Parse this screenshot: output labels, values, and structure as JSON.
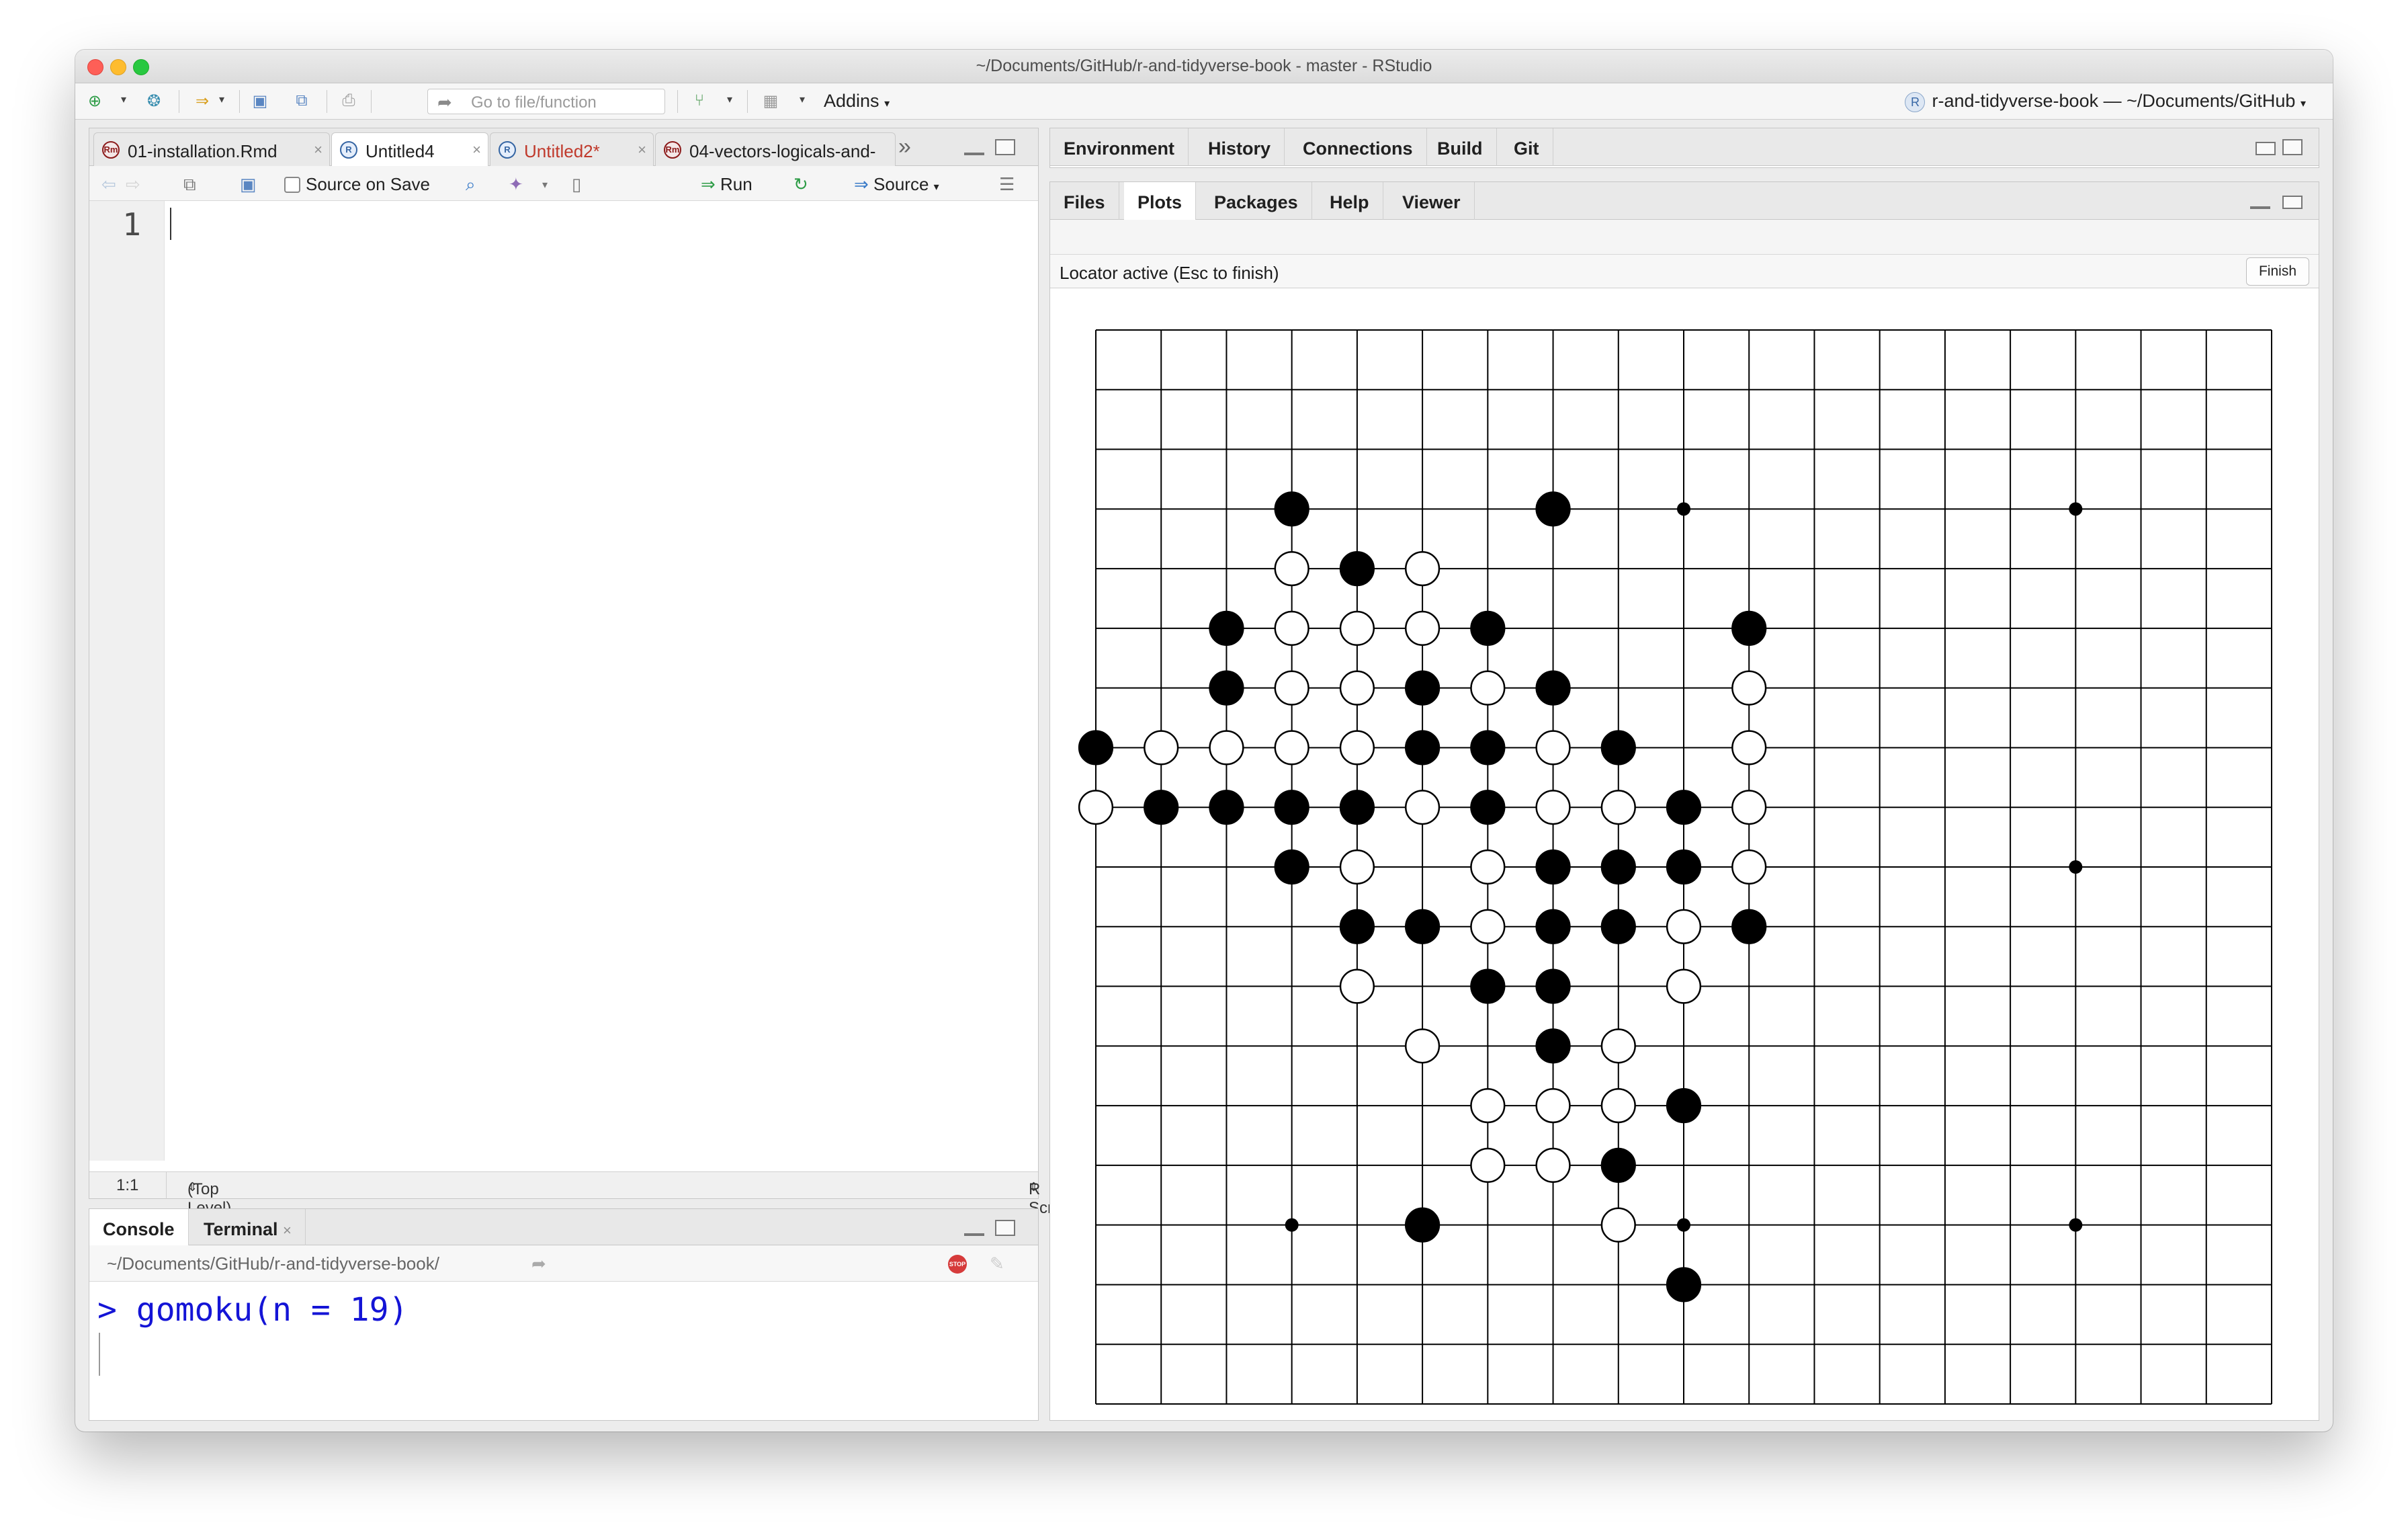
{
  "window": {
    "title": "~/Documents/GitHub/r-and-tidyverse-book - master - RStudio"
  },
  "toolbar": {
    "goto_placeholder": "Go to file/function",
    "addins_label": "Addins",
    "project_label": "r-and-tidyverse-book — ~/Documents/GitHub",
    "project_icon_letter": "R",
    "icons": [
      "new-file-icon",
      "new-project-icon",
      "open-file-icon",
      "save-icon",
      "save-all-icon",
      "print-icon",
      "git-icon",
      "workspace-panes-icon"
    ]
  },
  "editor": {
    "tabs": [
      {
        "label": "01-installation.Rmd",
        "icon": "rmd-file-icon"
      },
      {
        "label": "Untitled4",
        "icon": "r-file-icon"
      },
      {
        "label": "Untitled2*",
        "icon": "r-file-icon"
      },
      {
        "label": "04-vectors-logicals-and-",
        "icon": "rmd-file-icon"
      }
    ],
    "overflow_label": "»",
    "source_on_save": "Source on Save",
    "run_label": "Run",
    "source_label": "Source",
    "line_number": "1",
    "status": {
      "position": "1:1",
      "scope": "(Top Level)",
      "file_type": "R Script"
    }
  },
  "console": {
    "tabs": [
      "Console",
      "Terminal"
    ],
    "path": "~/Documents/GitHub/r-and-tidyverse-book/",
    "command": "> gomoku(n = 19)"
  },
  "env_pane": {
    "tabs": [
      "Environment",
      "History",
      "Connections",
      "Build",
      "Git"
    ]
  },
  "files_pane": {
    "tabs": [
      "Files",
      "Plots",
      "Packages",
      "Help",
      "Viewer"
    ],
    "active_tab": "Plots",
    "locator_text": "Locator active (Esc to finish)",
    "finish_label": "Finish"
  },
  "chart_data": {
    "type": "scatter",
    "title": "",
    "xlabel": "",
    "ylabel": "",
    "grid": true,
    "board_size": 19,
    "xlim": [
      1,
      19
    ],
    "ylim": [
      1,
      19
    ],
    "star_points": [
      [
        10,
        16
      ],
      [
        16,
        16
      ],
      [
        16,
        10
      ],
      [
        4,
        4
      ],
      [
        10,
        4
      ],
      [
        16,
        4
      ]
    ],
    "series": [
      {
        "color": "#000000",
        "points": [
          [
            4,
            16
          ],
          [
            8,
            16
          ],
          [
            5,
            15
          ],
          [
            3,
            14
          ],
          [
            7,
            14
          ],
          [
            11,
            14
          ],
          [
            3,
            13
          ],
          [
            6,
            13
          ],
          [
            8,
            13
          ],
          [
            1,
            12
          ],
          [
            6,
            12
          ],
          [
            7,
            12
          ],
          [
            9,
            12
          ],
          [
            2,
            11
          ],
          [
            3,
            11
          ],
          [
            4,
            11
          ],
          [
            5,
            11
          ],
          [
            7,
            11
          ],
          [
            10,
            11
          ],
          [
            4,
            10
          ],
          [
            8,
            10
          ],
          [
            9,
            10
          ],
          [
            10,
            10
          ],
          [
            5,
            9
          ],
          [
            6,
            9
          ],
          [
            8,
            9
          ],
          [
            9,
            9
          ],
          [
            11,
            9
          ],
          [
            7,
            8
          ],
          [
            8,
            8
          ],
          [
            8,
            7
          ],
          [
            10,
            6
          ],
          [
            9,
            5
          ],
          [
            6,
            4
          ],
          [
            10,
            3
          ]
        ]
      },
      {
        "color": "#ffffff",
        "points": [
          [
            4,
            15
          ],
          [
            6,
            15
          ],
          [
            4,
            14
          ],
          [
            5,
            14
          ],
          [
            6,
            14
          ],
          [
            4,
            13
          ],
          [
            5,
            13
          ],
          [
            7,
            13
          ],
          [
            11,
            13
          ],
          [
            2,
            12
          ],
          [
            3,
            12
          ],
          [
            4,
            12
          ],
          [
            5,
            12
          ],
          [
            8,
            12
          ],
          [
            11,
            12
          ],
          [
            1,
            11
          ],
          [
            6,
            11
          ],
          [
            8,
            11
          ],
          [
            9,
            11
          ],
          [
            11,
            11
          ],
          [
            5,
            10
          ],
          [
            7,
            10
          ],
          [
            11,
            10
          ],
          [
            7,
            9
          ],
          [
            10,
            9
          ],
          [
            5,
            8
          ],
          [
            10,
            8
          ],
          [
            6,
            7
          ],
          [
            9,
            7
          ],
          [
            7,
            6
          ],
          [
            8,
            6
          ],
          [
            9,
            6
          ],
          [
            7,
            5
          ],
          [
            8,
            5
          ],
          [
            9,
            4
          ]
        ]
      }
    ]
  }
}
